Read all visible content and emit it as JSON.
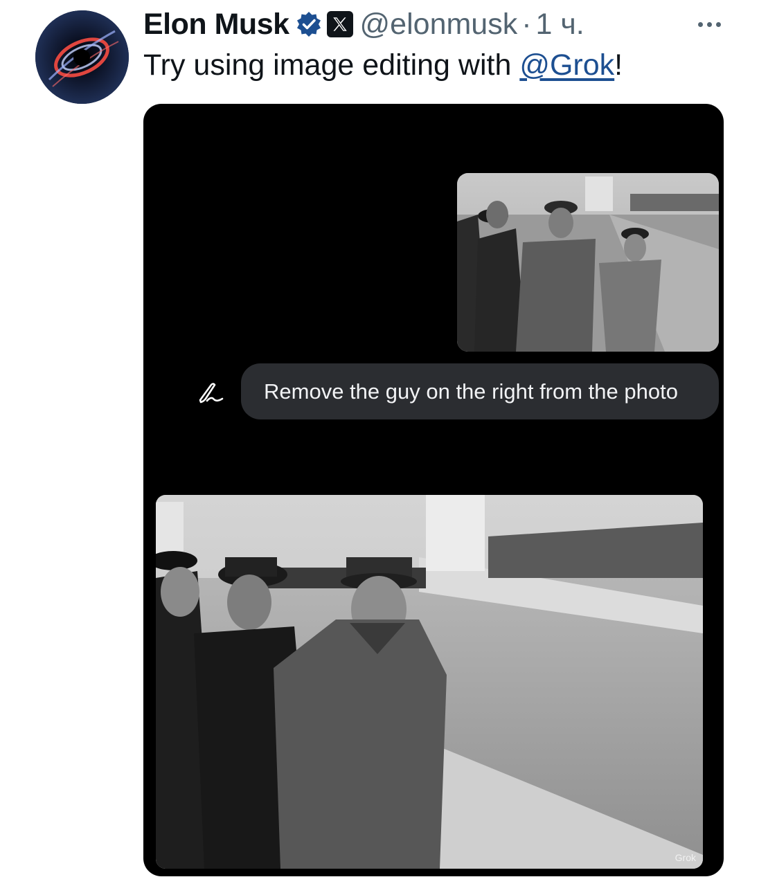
{
  "post": {
    "author_name": "Elon Musk",
    "handle": "@elonmusk",
    "separator": "·",
    "time": "1 ч.",
    "text_prefix": "Try using image editing with ",
    "mention": "@Grok",
    "text_suffix": "!"
  },
  "media": {
    "prompt_text": "Remove the guy on the right from the photo",
    "watermark": "Grok"
  },
  "icons": {
    "verified": "verified-badge-icon",
    "affiliate": "x-logo-icon",
    "more": "more-icon",
    "edit": "edit-pen-icon"
  },
  "colors": {
    "mention": "#1d4f91",
    "verified": "#1d4f91",
    "secondary_text": "#536471",
    "prompt_bubble": "#2b2d31",
    "media_bg": "#000000"
  }
}
